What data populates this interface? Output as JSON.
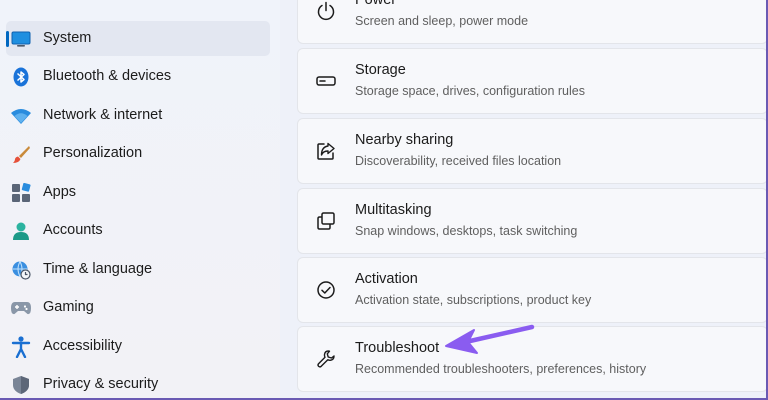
{
  "sidebar": {
    "items": [
      {
        "label": "System",
        "icon": "monitor-icon",
        "selected": true
      },
      {
        "label": "Bluetooth & devices",
        "icon": "bluetooth-icon"
      },
      {
        "label": "Network & internet",
        "icon": "wifi-icon"
      },
      {
        "label": "Personalization",
        "icon": "brush-icon"
      },
      {
        "label": "Apps",
        "icon": "apps-icon"
      },
      {
        "label": "Accounts",
        "icon": "person-icon"
      },
      {
        "label": "Time & language",
        "icon": "globe-clock-icon"
      },
      {
        "label": "Gaming",
        "icon": "gamepad-icon"
      },
      {
        "label": "Accessibility",
        "icon": "accessibility-icon"
      },
      {
        "label": "Privacy & security",
        "icon": "shield-icon"
      }
    ]
  },
  "main": {
    "cards": [
      {
        "title": "Power",
        "subtitle": "Screen and sleep, power mode",
        "icon": "power-icon"
      },
      {
        "title": "Storage",
        "subtitle": "Storage space, drives, configuration rules",
        "icon": "storage-icon"
      },
      {
        "title": "Nearby sharing",
        "subtitle": "Discoverability, received files location",
        "icon": "share-icon"
      },
      {
        "title": "Multitasking",
        "subtitle": "Snap windows, desktops, task switching",
        "icon": "multitasking-icon"
      },
      {
        "title": "Activation",
        "subtitle": "Activation state, subscriptions, product key",
        "icon": "checkmark-circle-icon"
      },
      {
        "title": "Troubleshoot",
        "subtitle": "Recommended troubleshooters, preferences, history",
        "icon": "wrench-icon"
      }
    ]
  },
  "colors": {
    "accent": "#0067c0",
    "annotation_arrow": "#8a5cf0"
  }
}
